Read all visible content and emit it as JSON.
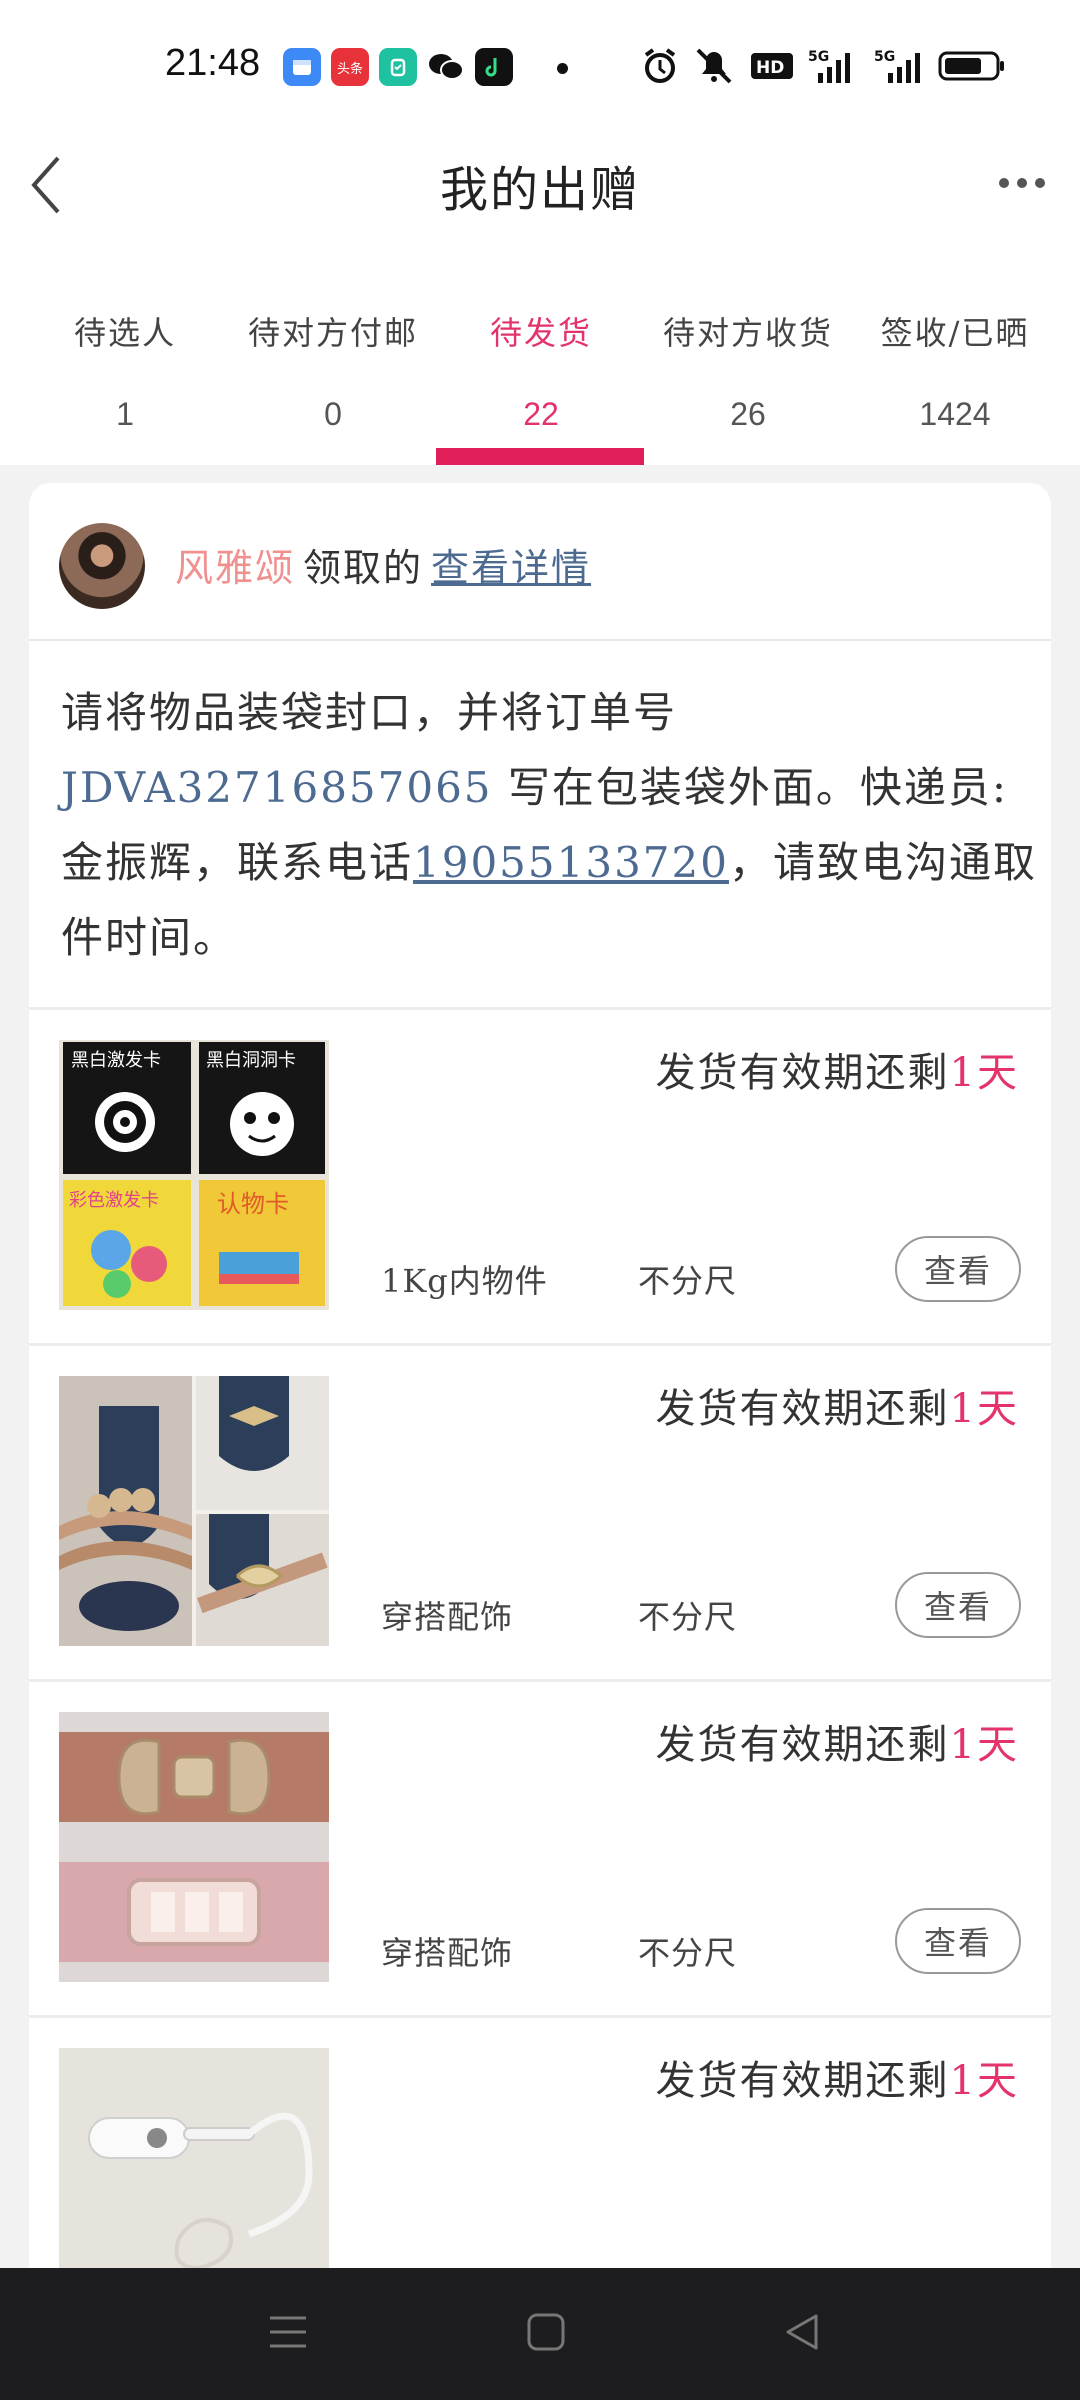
{
  "status_bar": {
    "time": "21:48",
    "app_icons": [
      "calendar-app-icon",
      "toutiao-icon",
      "mi-home-icon",
      "wechat-icon",
      "douyin-icon"
    ],
    "toutiao_label": "头条",
    "right_icons": [
      "alarm-icon",
      "mute-icon",
      "hd-icon",
      "signal-5g-icon",
      "signal-5g-icon-2",
      "battery-icon"
    ]
  },
  "header": {
    "title": "我的出赠"
  },
  "tabs": [
    {
      "label": "待选人",
      "count": "1"
    },
    {
      "label": "待对方付邮",
      "count": "0"
    },
    {
      "label": "待发货",
      "count": "22"
    },
    {
      "label": "待对方收货",
      "count": "26"
    },
    {
      "label": "签收/已晒",
      "count": "1424"
    }
  ],
  "active_tab_index": 2,
  "claimer": {
    "name": "风雅颂",
    "text": "领取的",
    "link": "查看详情"
  },
  "instructions": {
    "part1": "请将物品装袋封口，并将订单号 ",
    "order_no": "JDVA32716857065",
    "part2": " 写在包装袋外面。快递员:金振辉，联系电话",
    "phone": "19055133720",
    "part3": "，请致电沟通取件时间。"
  },
  "items": [
    {
      "deadline_prefix": "发货有效期还剩",
      "deadline_days": "1天",
      "category": "1Kg内物件",
      "size": "不分尺",
      "button": "查看",
      "image": "baby-flash-cards-photo",
      "card_texts": [
        "黑白激发卡",
        "黑白洞洞卡",
        "彩色激发卡",
        "认物卡"
      ]
    },
    {
      "deadline_prefix": "发货有效期还剩",
      "deadline_days": "1天",
      "category": "穿搭配饰",
      "size": "不分尺",
      "button": "查看",
      "image": "belt-collage-photo"
    },
    {
      "deadline_prefix": "发货有效期还剩",
      "deadline_days": "1天",
      "category": "穿搭配饰",
      "size": "不分尺",
      "button": "查看",
      "image": "bow-belt-photo"
    },
    {
      "deadline_prefix": "发货有效期还剩",
      "deadline_days": "1天",
      "category": "",
      "size": "",
      "button": "",
      "image": "bluetooth-earpiece-photo"
    }
  ],
  "colors": {
    "accent": "#e2336b",
    "link": "#4d6a91",
    "claimer_name": "#f0908f",
    "navbar": "#1d1d1f"
  },
  "nav_bar": {
    "buttons": [
      "menu-icon",
      "home-icon",
      "back-triangle-icon"
    ]
  }
}
